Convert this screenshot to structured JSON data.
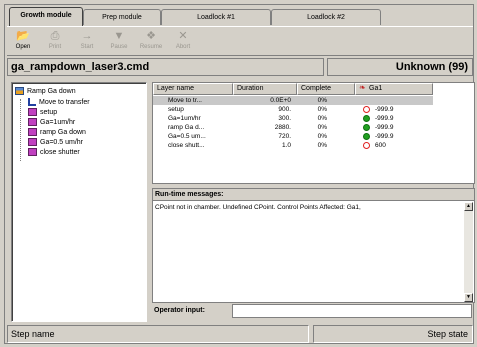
{
  "tabs": [
    {
      "label": "Growth module",
      "active": true
    },
    {
      "label": "Prep module",
      "active": false
    },
    {
      "label": "Loadlock #1",
      "active": false
    },
    {
      "label": "Loadlock #2",
      "active": false
    }
  ],
  "toolbar": {
    "open": {
      "label": "Open",
      "icon": "folder-open-icon"
    },
    "print": {
      "label": "Print",
      "icon": "printer-icon"
    },
    "start": {
      "label": "Start",
      "icon": "arrow-right-icon"
    },
    "pause": {
      "label": "Pause",
      "icon": "pause-icon"
    },
    "resume": {
      "label": "Resume",
      "icon": "resume-icon"
    },
    "abort": {
      "label": "Abort",
      "icon": "x-icon"
    }
  },
  "header": {
    "filename": "ga_rampdown_laser3.cmd",
    "state": "Unknown (99)"
  },
  "tree": {
    "root": "Ramp Ga down",
    "items": [
      "Move to transfer",
      "setup",
      "Ga=1um/hr",
      "ramp Ga down",
      "Ga=0.5 um/hr",
      "close shutter"
    ]
  },
  "layers": {
    "columns": [
      "Layer name",
      "Duration",
      "Complete",
      "Ga1"
    ],
    "rows": [
      {
        "name": "Move to tr...",
        "duration": "0.0E+0",
        "complete": "0%",
        "indicator": "none",
        "ga1": ""
      },
      {
        "name": "setup",
        "duration": "900.",
        "complete": "0%",
        "indicator": "empty",
        "ga1": "-999.9"
      },
      {
        "name": "Ga=1um/hr",
        "duration": "300.",
        "complete": "0%",
        "indicator": "green",
        "ga1": "-999.9"
      },
      {
        "name": "ramp Ga d...",
        "duration": "2880.",
        "complete": "0%",
        "indicator": "green",
        "ga1": "-999.9"
      },
      {
        "name": "Ga=0.5 um...",
        "duration": "720.",
        "complete": "0%",
        "indicator": "green",
        "ga1": "-999.9"
      },
      {
        "name": "close shutt...",
        "duration": "1.0",
        "complete": "0%",
        "indicator": "empty",
        "ga1": "600"
      }
    ]
  },
  "messages": {
    "title": "Run-time messages:",
    "text": "CPoint not in chamber.  Undefined CPoint.  Control Points Affected: Ga1,"
  },
  "operator_input": {
    "label": "Operator input:",
    "value": ""
  },
  "status": {
    "left": "Step name",
    "right": "Step state"
  },
  "colors": {
    "background": "#d4d0c8",
    "indicator_green": "#20a020",
    "indicator_red": "#e02020"
  }
}
